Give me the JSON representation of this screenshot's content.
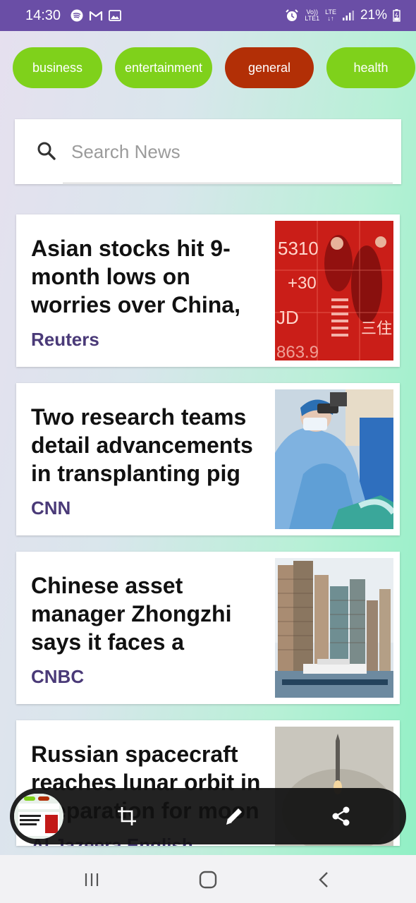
{
  "status_bar": {
    "time": "14:30",
    "left_icons": [
      "spotify-icon",
      "gmail-icon",
      "gallery-icon"
    ],
    "right_icons": [
      "alarm-icon",
      "volte-icon",
      "lte-icon",
      "signal-icon"
    ],
    "volte_label": "Vo))",
    "lte1_label": "LTE1",
    "lte_label": "LTE",
    "battery": "21%"
  },
  "categories": [
    {
      "label": "business",
      "active": false
    },
    {
      "label": "entertainment",
      "active": false
    },
    {
      "label": "general",
      "active": true
    },
    {
      "label": "health",
      "active": false
    }
  ],
  "colors": {
    "status_bar": "#6a4ea6",
    "chip": "#7fd11b",
    "chip_active": "#b22f06",
    "source": "#4a3a78"
  },
  "search": {
    "placeholder": "Search News",
    "icon": "search-icon"
  },
  "articles": [
    {
      "title": "Asian stocks hit 9-month lows on worries over China,",
      "source": "Reuters",
      "thumb": "stock-board-image"
    },
    {
      "title": "Two research teams detail advancements in transplanting pig",
      "source": "CNN",
      "thumb": "surgeon-image"
    },
    {
      "title": "Chinese asset manager Zhongzhi says it faces a",
      "source": "CNBC",
      "thumb": "city-skyline-image"
    },
    {
      "title": "Russian spacecraft reaches lunar orbit in preparation for moon",
      "source": "Al Jazeera English",
      "thumb": "rocket-launch-image"
    }
  ],
  "screenshot_toolbar": {
    "actions": [
      "crop-icon",
      "edit-icon",
      "share-icon"
    ]
  },
  "nav_bar": {
    "buttons": [
      "recents-icon",
      "home-icon",
      "back-icon"
    ]
  }
}
